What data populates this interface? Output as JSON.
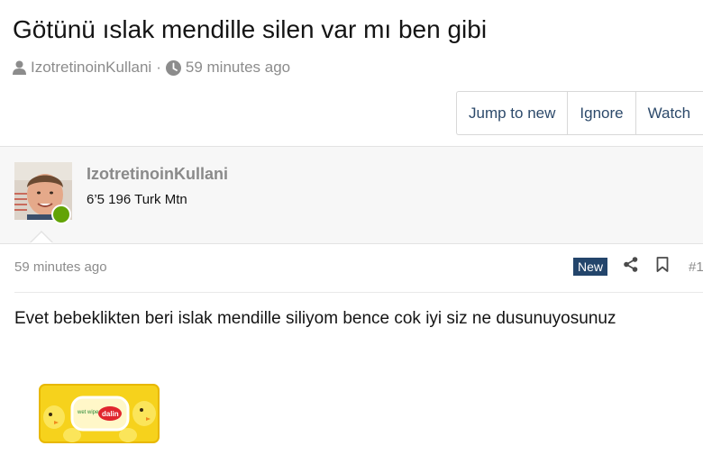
{
  "thread": {
    "title": "Götünü ıslak mendille silen var mı ben gibi",
    "author": "IzotretinoinKullani",
    "separator": "·",
    "time": "59 minutes ago"
  },
  "actions": {
    "jump_to_new": "Jump to new",
    "ignore": "Ignore",
    "watch": "Watch"
  },
  "post": {
    "author": "IzotretinoinKullani",
    "user_title": "6’5 196 Turk Mtn",
    "time": "59 minutes ago",
    "badge": "New",
    "post_number": "#1",
    "body": "Evet bebeklikten beri islak mendille siliyom bence cok iyi siz ne dusunuyosunuz",
    "online_color": "#62a305"
  },
  "image_brand": "dalin",
  "image_text": "wet wipes"
}
